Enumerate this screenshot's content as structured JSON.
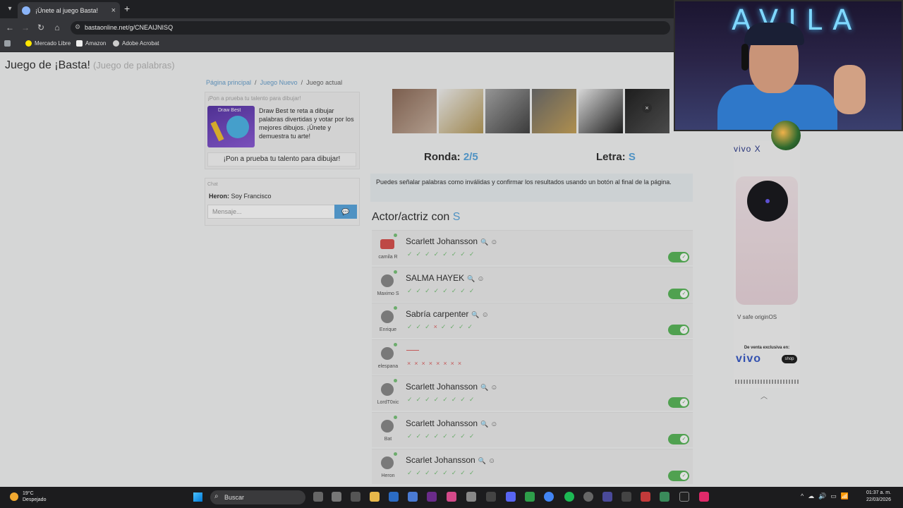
{
  "browser": {
    "tab_title": "¡Únete al juego Basta!",
    "url": "bastaonline.net/g/CNEAIJNISQ",
    "bookmarks": [
      "Mercado Libre",
      "Amazon",
      "Adobe Acrobat"
    ]
  },
  "page": {
    "title": "Juego de ¡Basta!",
    "subtitle": "(Juego de palabras)",
    "breadcrumb": [
      "Página principal",
      "Juego Nuevo",
      "Juego actual"
    ]
  },
  "promo": {
    "heading": "¡Pon a prueba tu talento para dibujar!",
    "image_title": "Draw Best",
    "text": "Draw Best te reta a dibujar palabras divertidas y votar por los mejores dibujos. ¡Únete y demuestra tu arte!",
    "button": "¡Pon a prueba tu talento para dibujar!"
  },
  "chat": {
    "heading": "Chat",
    "message_user": "Heron:",
    "message_text": "Soy Francisco",
    "input_placeholder": "Mensaje..."
  },
  "game": {
    "round_label": "Ronda:",
    "round_value": "2/5",
    "letter_label": "Letra:",
    "letter_value": "S",
    "notice": "Puedes señalar palabras como inválidas y confirmar los resultados usando un botón al final de la página.",
    "category_label": "Actor/actriz con",
    "category_letter": "S"
  },
  "answers": [
    {
      "user": "camila R",
      "word": "Scarlett Johansson",
      "votes": [
        "ok",
        "ok",
        "ok",
        "ok",
        "ok",
        "ok",
        "ok",
        "ok"
      ],
      "accepted": true
    },
    {
      "user": "Maximo S",
      "word": "SALMA HAYEK",
      "votes": [
        "ok",
        "ok",
        "ok",
        "ok",
        "ok",
        "ok",
        "ok",
        "ok"
      ],
      "accepted": true
    },
    {
      "user": "Enrique",
      "word": "Sabría carpenter",
      "votes": [
        "ok",
        "ok",
        "ok",
        "no",
        "ok",
        "ok",
        "ok",
        "ok"
      ],
      "accepted": true
    },
    {
      "user": "elespana",
      "word": "",
      "votes": [
        "no",
        "no",
        "no",
        "no",
        "no",
        "no",
        "no",
        "no"
      ],
      "accepted": false
    },
    {
      "user": "LordT0xic",
      "word": "Scarlett Johansson",
      "votes": [
        "ok",
        "ok",
        "ok",
        "ok",
        "ok",
        "ok",
        "ok",
        "ok"
      ],
      "accepted": true
    },
    {
      "user": "Bat",
      "word": "Scarlett Johansson",
      "votes": [
        "ok",
        "ok",
        "ok",
        "ok",
        "ok",
        "ok",
        "ok",
        "ok"
      ],
      "accepted": true
    },
    {
      "user": "Heron",
      "word": "Scarlet Johansson",
      "votes": [
        "ok",
        "ok",
        "ok",
        "ok",
        "ok",
        "ok",
        "ok",
        "ok"
      ],
      "accepted": true
    }
  ],
  "ad": {
    "brand": "vivo X",
    "partners": "V safe   originOS",
    "sale_text": "De venta exclusiva en:",
    "logo": "vivo",
    "shop": "shop"
  },
  "webcam": {
    "neon_text": "AVILA"
  },
  "taskbar": {
    "temp": "19°C",
    "weather": "Despejado",
    "search_placeholder": "Buscar",
    "time": "01:37 a. m.",
    "date": "22/03/2026"
  },
  "colors": {
    "accent": "#5aa7de",
    "ok": "#7cc47c",
    "no": "#e06666",
    "toggle": "#5cb85c"
  }
}
